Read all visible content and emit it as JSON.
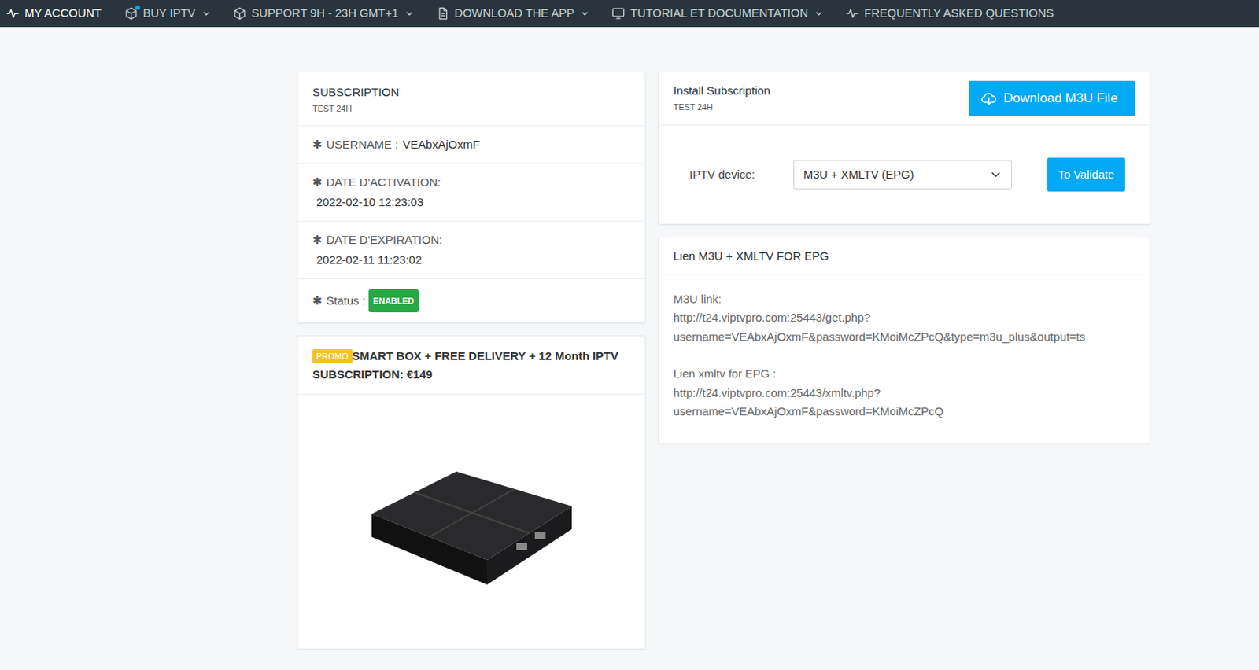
{
  "nav": {
    "items": [
      {
        "label": "MY ACCOUNT",
        "kind": "pulse",
        "selected": true,
        "menu": false,
        "dot": false
      },
      {
        "label": "BUY IPTV",
        "kind": "box",
        "selected": false,
        "menu": true,
        "dot": true
      },
      {
        "label": "SUPPORT 9H - 23H GMT+1",
        "kind": "box",
        "selected": false,
        "menu": true,
        "dot": false
      },
      {
        "label": "DOWNLOAD THE APP",
        "kind": "file",
        "selected": false,
        "menu": true,
        "dot": false
      },
      {
        "label": "TUTORIAL ET DOCUMENTATION",
        "kind": "monitor",
        "selected": false,
        "menu": true,
        "dot": false
      },
      {
        "label": "FREQUENTLY ASKED QUESTIONS",
        "kind": "pulse",
        "selected": false,
        "menu": false,
        "dot": false
      }
    ]
  },
  "subscription": {
    "title": "SUBSCRIPTION",
    "subtitle": "TEST 24H",
    "fields": [
      {
        "icon": "✱",
        "label": "USERNAME :",
        "value": "VEAbxAjOxmF",
        "kind": "inline"
      },
      {
        "icon": "✱",
        "label": "DATE D'ACTIVATION:",
        "value": "2022-02-10 12:23:03",
        "kind": "stacked"
      },
      {
        "icon": "✱",
        "label": "DATE D'EXPIRATION:",
        "value": "2022-02-11 11:23:02",
        "kind": "stacked"
      },
      {
        "icon": "✱",
        "label": "Status :",
        "value": "ENABLED",
        "kind": "badge"
      }
    ]
  },
  "promo": {
    "badge": "PROMO",
    "title": "SMART BOX + FREE DELIVERY + 12 Month IPTV SUBSCRIPTION: €149"
  },
  "install": {
    "title": "Install Subscription",
    "subtitle": "TEST 24H",
    "download_button": "Download M3U File",
    "device_label": "IPTV device:",
    "device_value": "M3U + XMLTV (EPG)",
    "validate_button": "To Validate"
  },
  "links": {
    "title": "Lien M3U + XMLTV FOR EPG",
    "items": [
      {
        "label": "M3U link:",
        "url": "http://t24.viptvpro.com:25443/get.php?username=VEAbxAjOxmF&password=KMoiMcZPcQ&type=m3u_plus&output=ts"
      },
      {
        "label": "Lien xmltv for EPG :",
        "url": "http://t24.viptvpro.com:25443/xmltv.php?username=VEAbxAjOxmF&password=KMoiMcZPcQ"
      }
    ]
  }
}
